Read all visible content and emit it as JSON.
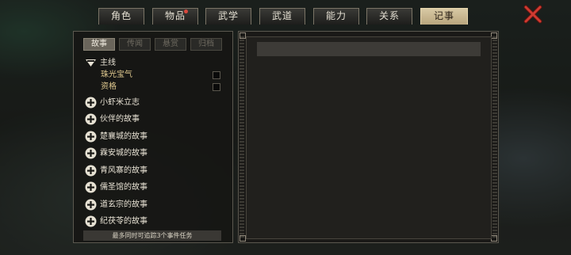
{
  "tabs": [
    {
      "label": "角色",
      "active": false
    },
    {
      "label": "物品",
      "active": false,
      "badge": true
    },
    {
      "label": "武学",
      "active": false
    },
    {
      "label": "武道",
      "active": false
    },
    {
      "label": "能力",
      "active": false
    },
    {
      "label": "关系",
      "active": false
    },
    {
      "label": "记事",
      "active": true
    }
  ],
  "close_icon": "close-x-icon",
  "subtabs": [
    {
      "label": "故事",
      "active": true
    },
    {
      "label": "传闻",
      "active": false
    },
    {
      "label": "悬赏",
      "active": false
    },
    {
      "label": "归档",
      "active": false
    }
  ],
  "tree": {
    "main": {
      "label": "主线",
      "expanded": true,
      "children": [
        {
          "label": "珠光宝气",
          "tracked": false
        },
        {
          "label": "资格",
          "tracked": false
        }
      ]
    },
    "groups": [
      {
        "label": "小虾米立志"
      },
      {
        "label": "伙伴的故事"
      },
      {
        "label": "楚襄城的故事"
      },
      {
        "label": "霖安城的故事"
      },
      {
        "label": "青风寨的故事"
      },
      {
        "label": "儒圣馆的故事"
      },
      {
        "label": "道玄宗的故事"
      },
      {
        "label": "纪茯苓的故事"
      }
    ]
  },
  "footer_note": "最多同时可追踪3个事件任务",
  "colors": {
    "active_tab": "#c9b88f",
    "badge": "#d8473c",
    "close": "#c8332b",
    "child_text": "#e0c98f"
  }
}
